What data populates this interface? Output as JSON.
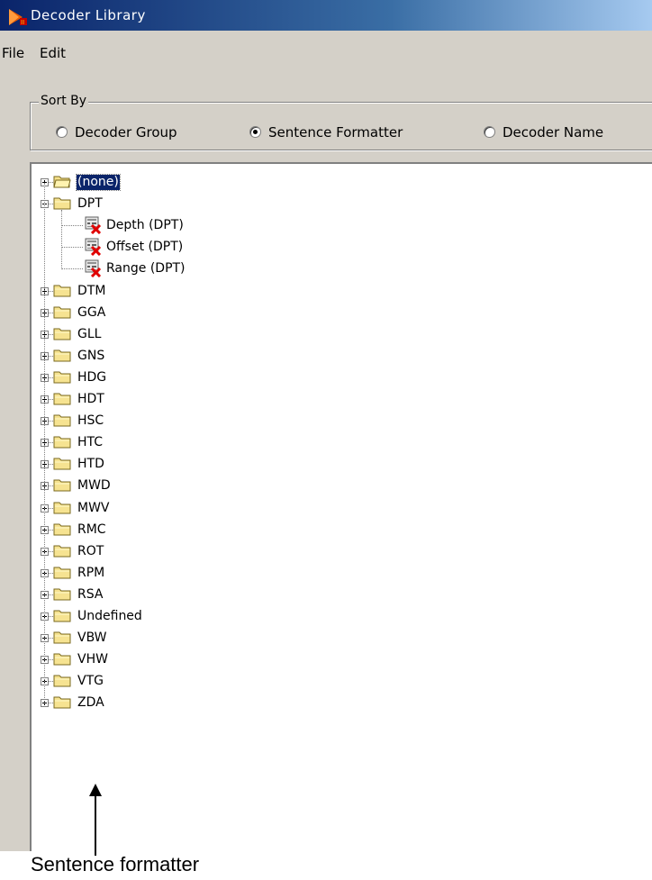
{
  "window": {
    "title": "Decoder Library"
  },
  "menu": [
    "File",
    "Edit"
  ],
  "sort_by": {
    "legend": "Sort By",
    "options": [
      {
        "label": "Decoder Group",
        "checked": false
      },
      {
        "label": "Sentence Formatter",
        "checked": true
      },
      {
        "label": "Decoder Name",
        "checked": false
      }
    ]
  },
  "tree": {
    "items": [
      {
        "label": "(none)",
        "type": "folder",
        "expander": "+",
        "selected": true,
        "open": true
      },
      {
        "label": "DPT",
        "type": "folder",
        "expander": "-",
        "selected": false,
        "open": false
      },
      {
        "label": "Depth (DPT)",
        "type": "decoder",
        "icon": "decoder-error-icon"
      },
      {
        "label": "Offset (DPT)",
        "type": "decoder",
        "icon": "decoder-error-icon"
      },
      {
        "label": "Range (DPT)",
        "type": "decoder",
        "icon": "decoder-error-icon"
      },
      {
        "label": "DTM",
        "type": "folder",
        "expander": "+"
      },
      {
        "label": "GGA",
        "type": "folder",
        "expander": "+"
      },
      {
        "label": "GLL",
        "type": "folder",
        "expander": "+"
      },
      {
        "label": "GNS",
        "type": "folder",
        "expander": "+"
      },
      {
        "label": "HDG",
        "type": "folder",
        "expander": "+"
      },
      {
        "label": "HDT",
        "type": "folder",
        "expander": "+"
      },
      {
        "label": "HSC",
        "type": "folder",
        "expander": "+"
      },
      {
        "label": "HTC",
        "type": "folder",
        "expander": "+"
      },
      {
        "label": "HTD",
        "type": "folder",
        "expander": "+"
      },
      {
        "label": "MWD",
        "type": "folder",
        "expander": "+"
      },
      {
        "label": "MWV",
        "type": "folder",
        "expander": "+"
      },
      {
        "label": "RMC",
        "type": "folder",
        "expander": "+"
      },
      {
        "label": "ROT",
        "type": "folder",
        "expander": "+"
      },
      {
        "label": "RPM",
        "type": "folder",
        "expander": "+"
      },
      {
        "label": "RSA",
        "type": "folder",
        "expander": "+"
      },
      {
        "label": "Undefined",
        "type": "folder",
        "expander": "+"
      },
      {
        "label": "VBW",
        "type": "folder",
        "expander": "+"
      },
      {
        "label": "VHW",
        "type": "folder",
        "expander": "+"
      },
      {
        "label": "VTG",
        "type": "folder",
        "expander": "+"
      },
      {
        "label": "ZDA",
        "type": "folder",
        "expander": "+"
      }
    ]
  },
  "annotation": {
    "caption": "Sentence formatter"
  },
  "colors": {
    "title_bar": "#0a246a",
    "window_bg": "#d4d0c8",
    "selection": "#0a246a",
    "error_x": "#e00000"
  }
}
